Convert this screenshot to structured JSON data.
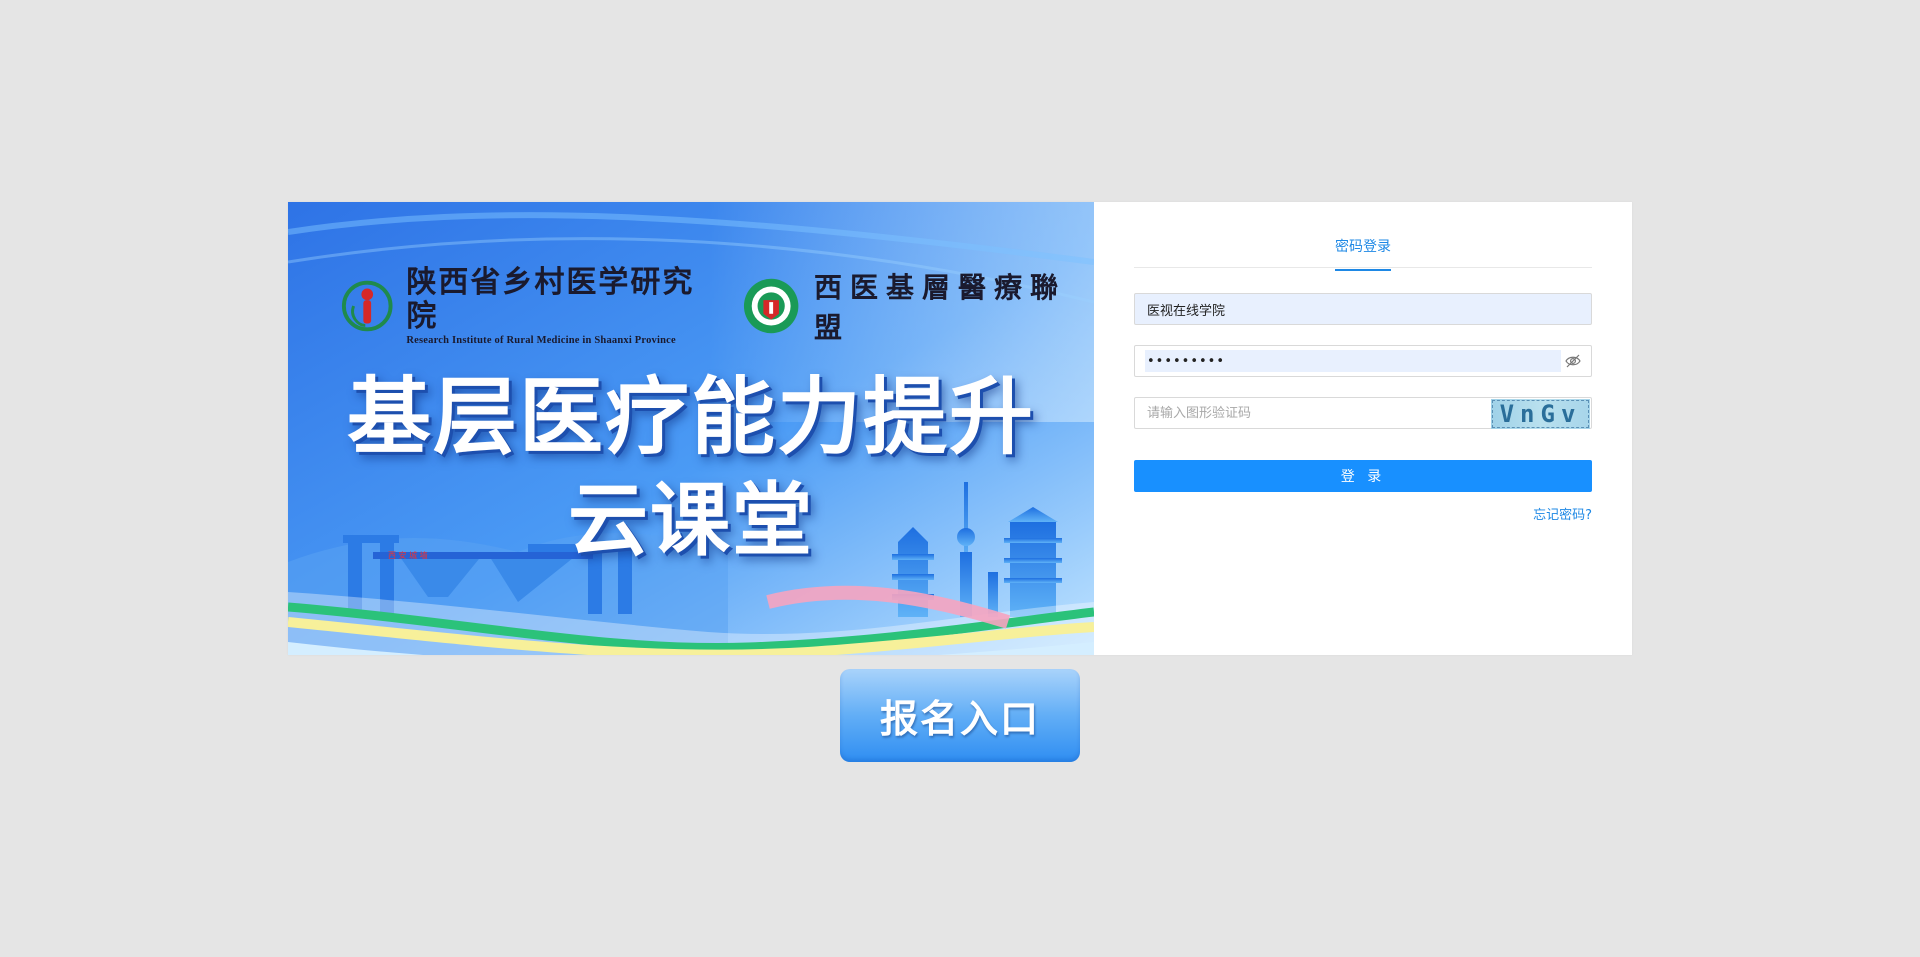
{
  "banner": {
    "logo1_cn": "陕西省乡村医学研究院",
    "logo1_en": "Research Institute of  Rural Medicine in Shaanxi Province",
    "logo2_cn": "西医基層醫療聯盟",
    "headline_line1": "基层医疗能力提升",
    "headline_line2": "云课堂"
  },
  "login": {
    "tab_label": "密码登录",
    "username_value": "医视在线学院",
    "password_value": "•••••••••",
    "captcha_placeholder": "请输入图形验证码",
    "captcha_text": "VnGv",
    "login_button": "登 录",
    "forgot_link": "忘记密码?"
  },
  "register_button": "报名入口",
  "colors": {
    "accent": "#1890ff",
    "page_bg": "#e5e5e5",
    "autofill_bg": "#e8f0fe"
  },
  "icons": {
    "password_toggle": "eye-slash-icon"
  }
}
